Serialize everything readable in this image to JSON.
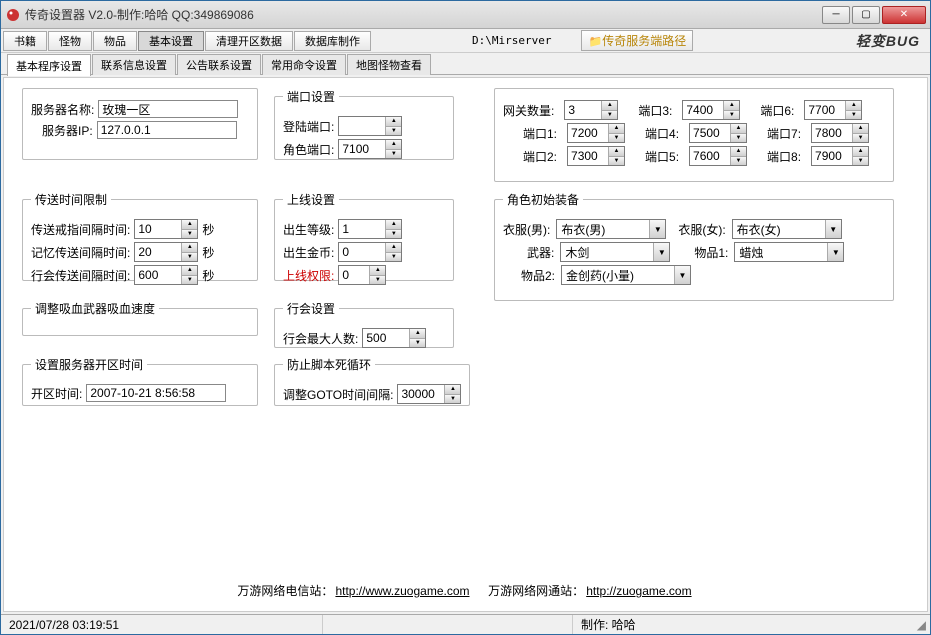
{
  "window": {
    "title": "传奇设置器 V2.0-制作:哈哈 QQ:349869086"
  },
  "toolbar": {
    "btns": [
      "书籍",
      "怪物",
      "物品",
      "基本设置",
      "清理开区数据",
      "数据库制作"
    ],
    "path": "D:\\Mirserver",
    "path_btn": "传奇服务端路径",
    "brand": "轻变BUG"
  },
  "tabs": [
    "基本程序设置",
    "联系信息设置",
    "公告联系设置",
    "常用命令设置",
    "地图怪物查看"
  ],
  "active_tab": 0,
  "group_server": {
    "name_label": "服务器名称:",
    "name_value": "玫瑰一区",
    "ip_label": "服务器IP:",
    "ip_value": "127.0.0.1"
  },
  "group_transfer": {
    "legend": "传送时间限制",
    "r1_label": "传送戒指间隔时间:",
    "r1_val": "10",
    "unit": "秒",
    "r2_label": "记忆传送间隔时间:",
    "r2_val": "20",
    "r3_label": "行会传送间隔时间:",
    "r3_val": "600"
  },
  "group_blood": {
    "legend": "调整吸血武器吸血速度"
  },
  "group_opentime": {
    "legend": "设置服务器开区时间",
    "label": "开区时间:",
    "value": "2007-10-21 8:56:58"
  },
  "group_port": {
    "legend": "端口设置",
    "login_label": "登陆端口:",
    "login_val": "",
    "role_label": "角色端口:",
    "role_val": "7100"
  },
  "group_online": {
    "legend": "上线设置",
    "level_label": "出生等级:",
    "level_val": "1",
    "gold_label": "出生金币:",
    "gold_val": "0",
    "perm_label": "上线权限:",
    "perm_val": "0"
  },
  "group_guild": {
    "legend": "行会设置",
    "max_label": "行会最大人数:",
    "max_val": "500"
  },
  "group_script": {
    "legend": "防止脚本死循环",
    "goto_label": "调整GOTO时间间隔:",
    "goto_val": "30000"
  },
  "group_gateway": {
    "gw_label": "网关数量:",
    "gw_val": "3",
    "ports": [
      {
        "label": "端口1:",
        "val": "7200"
      },
      {
        "label": "端口2:",
        "val": "7300"
      },
      {
        "label": "端口3:",
        "val": "7400"
      },
      {
        "label": "端口4:",
        "val": "7500"
      },
      {
        "label": "端口5:",
        "val": "7600"
      },
      {
        "label": "端口6:",
        "val": "7700"
      },
      {
        "label": "端口7:",
        "val": "7800"
      },
      {
        "label": "端口8:",
        "val": "7900"
      }
    ]
  },
  "group_equip": {
    "legend": "角色初始装备",
    "cloth_m_label": "衣服(男):",
    "cloth_m_val": "布衣(男)",
    "cloth_f_label": "衣服(女):",
    "cloth_f_val": "布衣(女)",
    "weapon_label": "武器:",
    "weapon_val": "木剑",
    "item1_label": "物品1:",
    "item1_val": "蜡烛",
    "item2_label": "物品2:",
    "item2_val": "金创药(小量)"
  },
  "footer": {
    "dx_label": "万游网络电信站：",
    "dx_url": "http://www.zuogame.com",
    "wt_label": "万游网络网通站：",
    "wt_url": "http://zuogame.com"
  },
  "status": {
    "time": "2021/07/28 03:19:51",
    "credit": "制作: 哈哈"
  }
}
